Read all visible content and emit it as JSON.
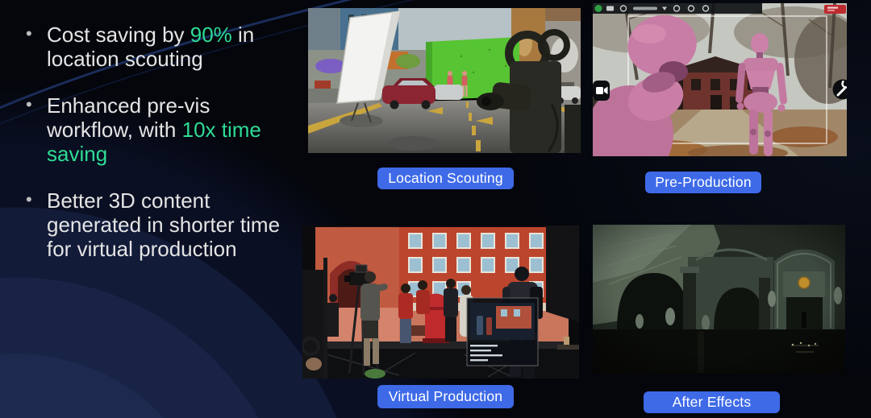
{
  "slide": {
    "background_color": "#04060c",
    "accent_green": "#2EDC96",
    "label_blue": "#3E6AE8",
    "text_color": "#E4E4E4"
  },
  "bullets": [
    {
      "pre": "Cost saving by ",
      "highlight": "90%",
      "post": " in location scouting"
    },
    {
      "pre": "Enhanced pre-vis workflow, with ",
      "highlight": "10x time saving",
      "post": ""
    },
    {
      "pre": "Better 3D content generated in shorter time for virtual production",
      "highlight": "",
      "post": ""
    }
  ],
  "gallery": {
    "items": [
      {
        "label": "Location Scouting",
        "image": "street-scene-with-green-screen"
      },
      {
        "label": "Pre-Production",
        "image": "previz-viewport-pink-mannequins"
      },
      {
        "label": "Virtual Production",
        "image": "led-wall-film-set"
      },
      {
        "label": "After Effects",
        "image": "dark-cathedral-interior"
      }
    ]
  },
  "icons": {
    "previz_status_dot": "green-status-dot",
    "previz_record_badge": "record-badge",
    "previz_camera_button": "video-camera-icon",
    "previz_tool_button": "wrench-icon"
  }
}
